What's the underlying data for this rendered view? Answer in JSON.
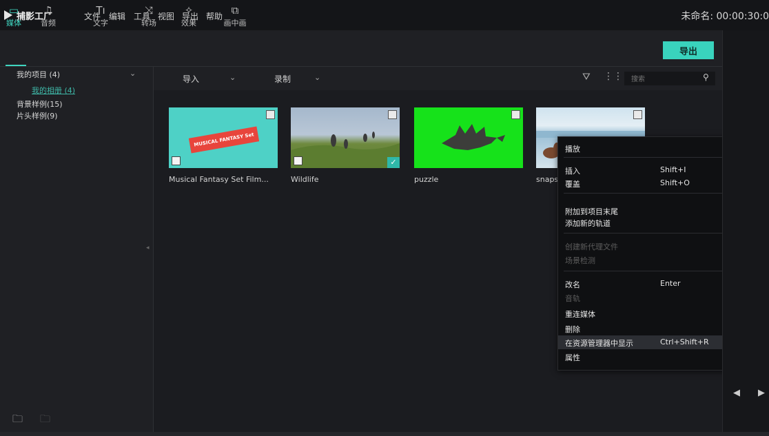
{
  "app": {
    "logo_text": "捕影工厂"
  },
  "menu": [
    {
      "label": "文件"
    },
    {
      "label": "编辑"
    },
    {
      "label": "工具"
    },
    {
      "label": "视图"
    },
    {
      "label": "导出"
    },
    {
      "label": "帮助"
    }
  ],
  "project_title": "未命名: 00:00:30:0",
  "toolbar": {
    "tabs": [
      {
        "label": "媒体",
        "icon": "folder-icon",
        "active": true
      },
      {
        "label": "音频",
        "icon": "music-note-icon"
      },
      {
        "label": "文字",
        "icon": "text-icon"
      },
      {
        "label": "转场",
        "icon": "transition-icon"
      },
      {
        "label": "效果",
        "icon": "effects-icon"
      },
      {
        "label": "画中画",
        "icon": "pip-icon"
      }
    ],
    "export_label": "导出"
  },
  "sidebar": {
    "items": [
      {
        "label": "我的项目 (4)"
      },
      {
        "label": "我的相册 (4)"
      },
      {
        "label": "背景样例(15)"
      },
      {
        "label": "片头样例(9)"
      }
    ]
  },
  "filterbar": {
    "import_label": "导入",
    "record_label": "录制",
    "search_placeholder": "搜索"
  },
  "media": [
    {
      "caption": "Musical Fantasy Set Film...",
      "thumb_text": "MUSICAL FANTASY Set"
    },
    {
      "caption": "Wildlife"
    },
    {
      "caption": "puzzle"
    },
    {
      "caption": "snaps"
    }
  ],
  "context_menu": {
    "items": [
      {
        "label": "播放"
      },
      {
        "label": "插入",
        "shortcut": "Shift+I"
      },
      {
        "label": "覆盖",
        "shortcut": "Shift+O"
      },
      {
        "label": "附加到项目末尾"
      },
      {
        "label": "添加新的轨道"
      },
      {
        "label": "创建新代理文件",
        "disabled": true
      },
      {
        "label": "场景检测",
        "disabled": true
      },
      {
        "label": "改名",
        "shortcut": "Enter"
      },
      {
        "label": "音轨",
        "disabled": true
      },
      {
        "label": "重连媒体"
      },
      {
        "label": "删除"
      },
      {
        "label": "在资源管理器中显示",
        "shortcut": "Ctrl+Shift+R",
        "highlighted": true
      },
      {
        "label": "属性"
      }
    ]
  },
  "colors": {
    "accent": "#39d3bd",
    "background": "#1f2024",
    "menu_bg": "#0f1012",
    "green_screen": "#16e21a"
  }
}
